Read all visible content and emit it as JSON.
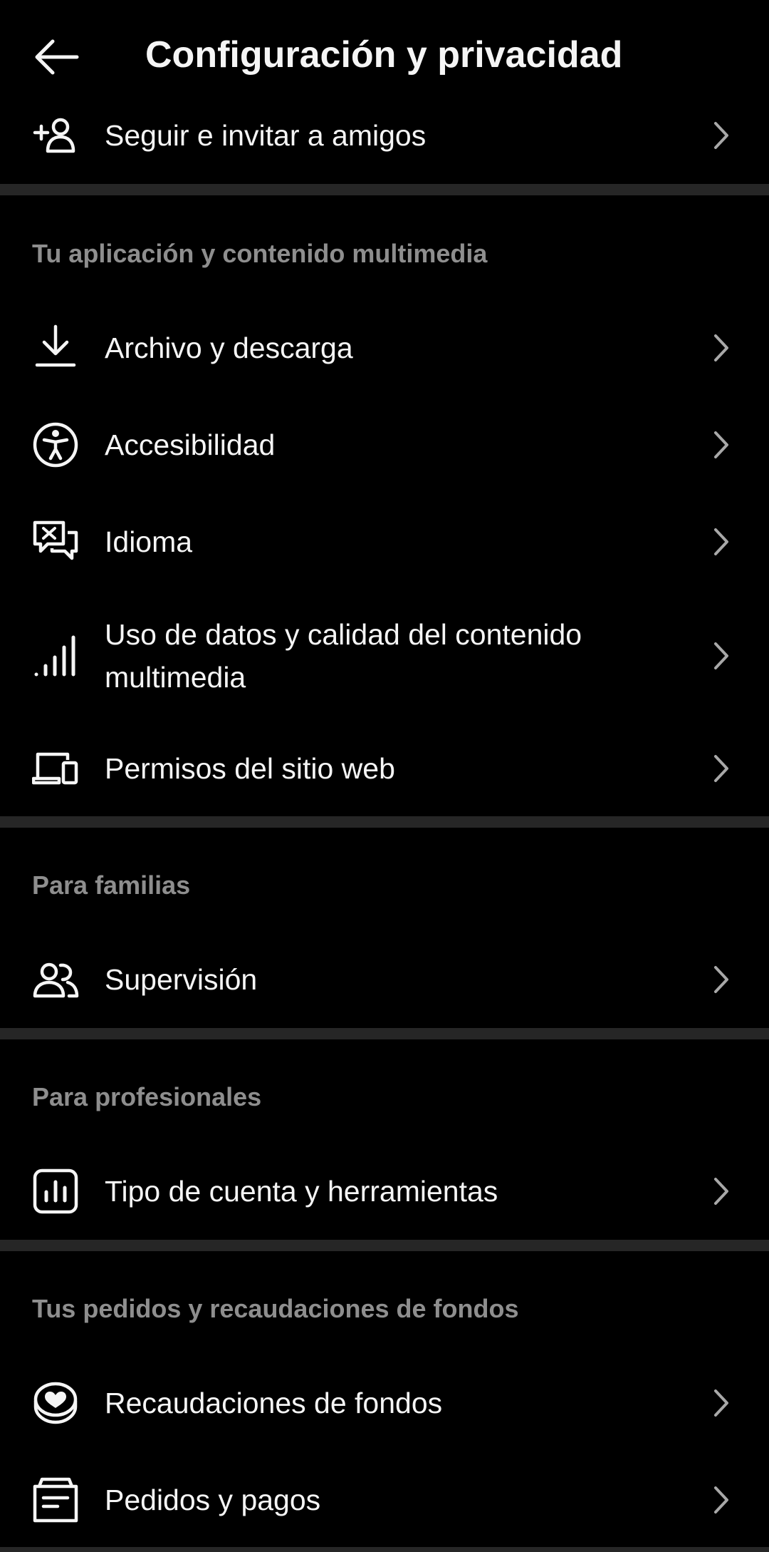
{
  "header": {
    "title": "Configuración y privacidad",
    "back_icon": "arrow-left-icon"
  },
  "top_item": {
    "label": "Seguir e invitar a amigos",
    "icon": "add-person-icon"
  },
  "sections": [
    {
      "title": "Tu aplicación y contenido multimedia",
      "items": [
        {
          "label": "Archivo y descarga",
          "icon": "download-icon"
        },
        {
          "label": "Accesibilidad",
          "icon": "accessibility-icon"
        },
        {
          "label": "Idioma",
          "icon": "language-icon"
        },
        {
          "label": "Uso de datos y calidad del contenido multimedia",
          "icon": "signal-bars-icon"
        },
        {
          "label": "Permisos del sitio web",
          "icon": "devices-icon"
        }
      ]
    },
    {
      "title": "Para familias",
      "items": [
        {
          "label": "Supervisión",
          "icon": "people-icon"
        }
      ]
    },
    {
      "title": "Para profesionales",
      "items": [
        {
          "label": "Tipo de cuenta y herramientas",
          "icon": "bar-chart-icon"
        }
      ]
    },
    {
      "title": "Tus pedidos y recaudaciones de fondos",
      "items": [
        {
          "label": "Recaudaciones de fondos",
          "icon": "heart-coin-icon"
        },
        {
          "label": "Pedidos y pagos",
          "icon": "receipt-icon"
        }
      ]
    }
  ],
  "colors": {
    "background": "#000000",
    "text": "#f5f5f5",
    "section_header": "#8e8e8e",
    "divider": "#262626",
    "chevron": "#a8a8a8"
  }
}
